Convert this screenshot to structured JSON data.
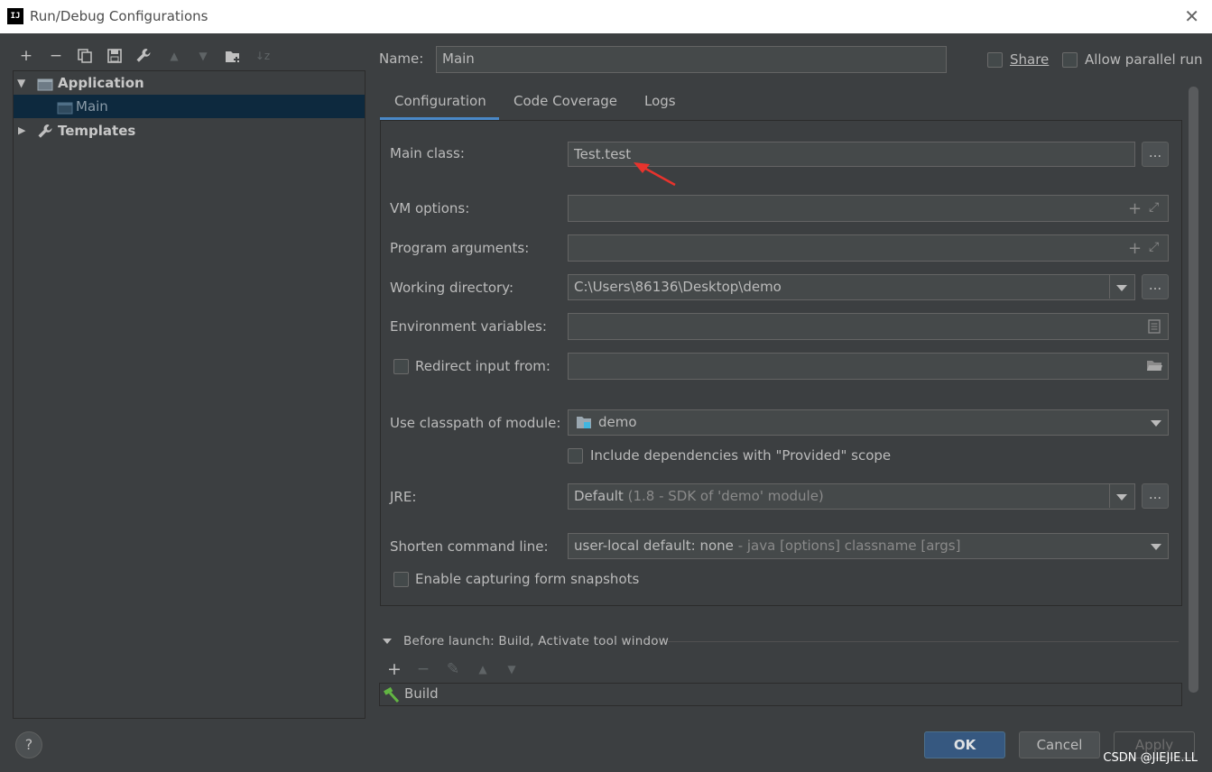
{
  "window": {
    "title": "Run/Debug Configurations",
    "app_icon": "IJ",
    "close_glyph": "✕"
  },
  "toolbar": {
    "add": "+",
    "remove": "−",
    "copy": "⧉",
    "save": "▣",
    "edit_defaults": "🔧",
    "move_up": "▲",
    "move_down": "▼",
    "folder": "📁",
    "sort": "↓z"
  },
  "tree": {
    "application": "Application",
    "main": "Main",
    "templates": "Templates"
  },
  "header": {
    "name_label": "Name:",
    "name_value": "Main",
    "share_label": "Share",
    "parallel_label": "Allow parallel run"
  },
  "tabs": [
    {
      "label": "Configuration",
      "active": true
    },
    {
      "label": "Code Coverage",
      "active": false
    },
    {
      "label": "Logs",
      "active": false
    }
  ],
  "form": {
    "main_class_label": "Main class:",
    "main_class_value": "Test.test",
    "vm_options_label": "VM options:",
    "vm_options_value": "",
    "program_args_label": "Program arguments:",
    "program_args_value": "",
    "working_dir_label": "Working directory:",
    "working_dir_value": "C:\\Users\\86136\\Desktop\\demo",
    "env_vars_label": "Environment variables:",
    "env_vars_value": "",
    "redirect_label": "Redirect input from:",
    "redirect_value": "",
    "classpath_label": "Use classpath of module:",
    "classpath_value": "demo",
    "include_deps_label": "Include dependencies with \"Provided\" scope",
    "jre_label": "JRE:",
    "jre_value": "Default",
    "jre_detail": "(1.8 - SDK of 'demo' module)",
    "shorten_label": "Shorten command line:",
    "shorten_value": "user-local default: none",
    "shorten_detail": "- java [options] classname [args]",
    "snapshots_label": "Enable capturing form snapshots",
    "browse_label": "..."
  },
  "before_launch": {
    "title": "Before launch: Build, Activate tool window",
    "items": [
      "Build"
    ]
  },
  "footer": {
    "help": "?",
    "ok": "OK",
    "cancel": "Cancel",
    "apply": "Apply"
  },
  "watermark": "CSDN @JIEJIE.LL",
  "colors": {
    "accent": "#4a88c7",
    "selection": "#0d293e",
    "annotation_arrow": "#e8332d"
  }
}
